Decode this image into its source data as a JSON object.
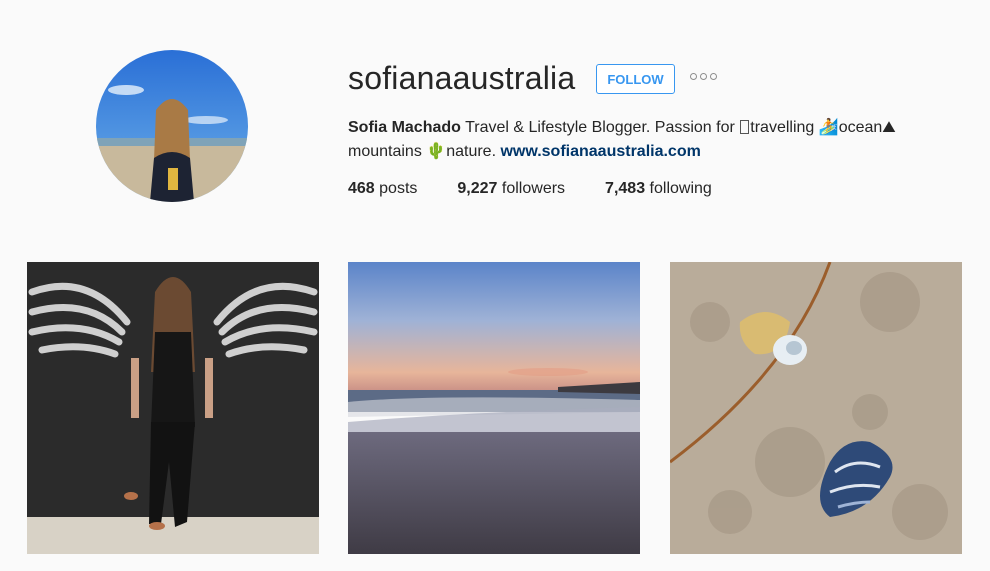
{
  "profile": {
    "username": "sofianaaustralia",
    "follow_label": "FOLLOW",
    "options_icon": "more-options-icon",
    "full_name": "Sofia Machado",
    "bio_text_1": "Travel & Lifestyle Blogger. Passion for",
    "bio_word_travelling": "travelling",
    "bio_word_ocean": "ocean",
    "bio_word_mountains": "mountains",
    "bio_word_nature": "nature.",
    "website": "www.sofianaaustralia.com"
  },
  "stats": {
    "posts_count": "468",
    "posts_label": "posts",
    "followers_count": "9,227",
    "followers_label": "followers",
    "following_count": "7,483",
    "following_label": "following"
  },
  "colors": {
    "accent": "#3897f0",
    "link": "#003569",
    "background": "#fafafa"
  }
}
